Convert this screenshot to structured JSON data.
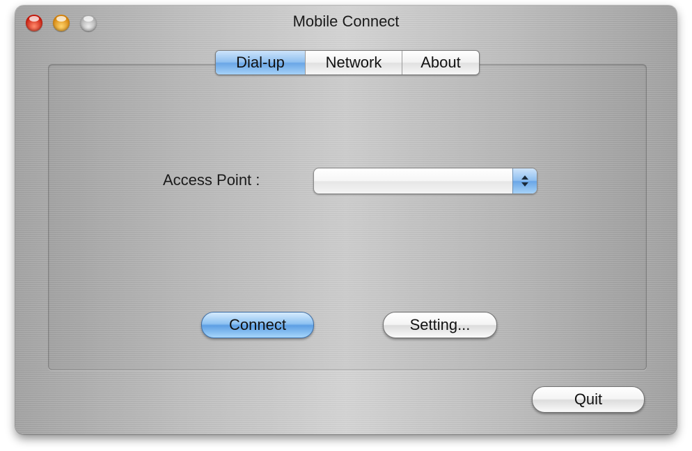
{
  "window": {
    "title": "Mobile Connect"
  },
  "tabs": [
    {
      "label": "Dial-up",
      "selected": true
    },
    {
      "label": "Network",
      "selected": false
    },
    {
      "label": "About",
      "selected": false
    }
  ],
  "form": {
    "access_point_label": "Access Point :",
    "access_point_value": ""
  },
  "buttons": {
    "connect": "Connect",
    "setting": "Setting...",
    "quit": "Quit"
  },
  "icons": {
    "close": "close-traffic-light-icon",
    "minimize": "minimize-traffic-light-icon",
    "zoom": "zoom-traffic-light-icon",
    "popup_arrows": "up-down-arrows-icon"
  },
  "colors": {
    "accent_blue": "#6aa6e6",
    "close_red": "#c5170a",
    "minimize_amber": "#d4820a",
    "zoom_gray": "#a8a8a8"
  }
}
